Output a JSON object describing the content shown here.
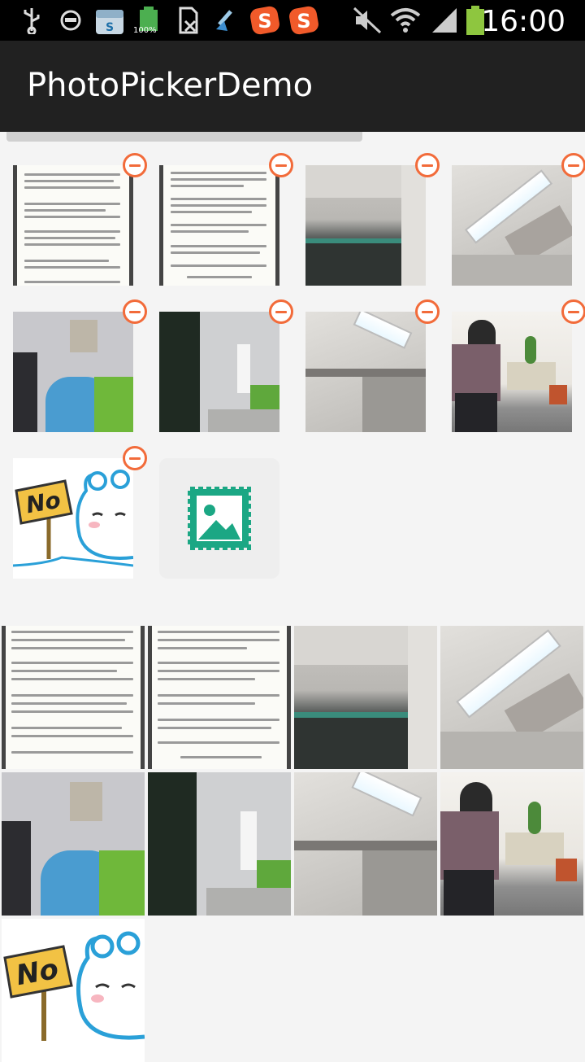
{
  "status_bar": {
    "time": "16:00",
    "battery_label": "100%",
    "icons": [
      "usb-icon",
      "sync-icon",
      "store-icon",
      "battery-app-icon",
      "sim-off-icon",
      "download-icon",
      "app-s-icon",
      "app-s-icon",
      "mute-icon",
      "wifi-icon",
      "signal-icon",
      "battery-icon"
    ]
  },
  "app_bar": {
    "title": "PhotoPickerDemo"
  },
  "picker": {
    "photos": [
      {
        "kind": "document"
      },
      {
        "kind": "document"
      },
      {
        "kind": "office-screens"
      },
      {
        "kind": "ceiling-light"
      },
      {
        "kind": "office-desk"
      },
      {
        "kind": "office-wall"
      },
      {
        "kind": "ceiling-light"
      },
      {
        "kind": "person-desk"
      },
      {
        "kind": "cartoon-no-sign"
      }
    ],
    "sign_text": "No",
    "remove_icon": "remove-circle-icon",
    "add_icon": "add-image-icon",
    "colors": {
      "remove": "#f26b3a",
      "add": "#1ba784"
    }
  },
  "preview": {
    "photos": [
      {
        "kind": "document"
      },
      {
        "kind": "document"
      },
      {
        "kind": "office-screens"
      },
      {
        "kind": "ceiling-light"
      },
      {
        "kind": "office-desk"
      },
      {
        "kind": "office-wall"
      },
      {
        "kind": "ceiling-light"
      },
      {
        "kind": "person-desk"
      },
      {
        "kind": "cartoon-no-sign"
      }
    ],
    "sign_text": "No"
  }
}
